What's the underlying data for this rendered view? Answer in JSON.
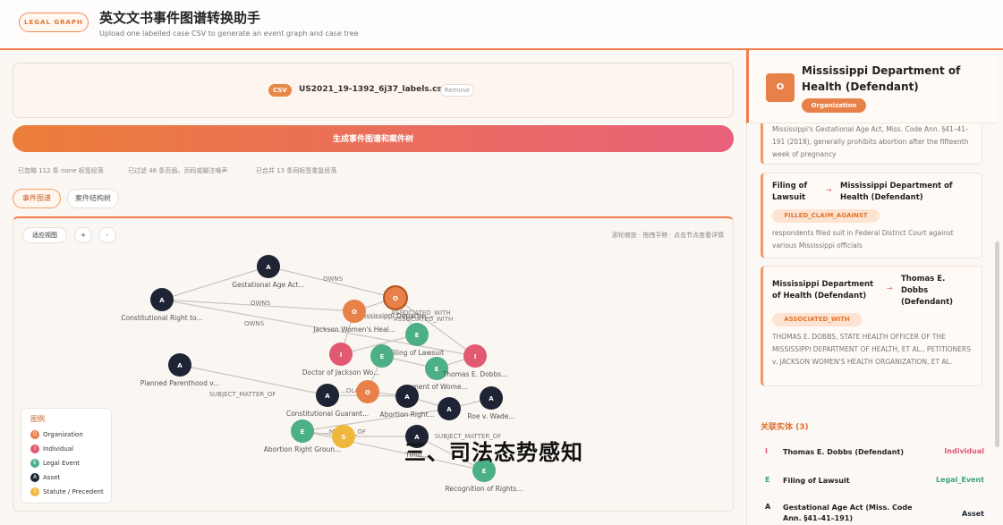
{
  "header": {
    "brand": "LEGAL GRAPH",
    "title": "英文文书事件图谱转换助手",
    "subtitle": "Upload one labelled case CSV to generate an event graph and case tree"
  },
  "upload": {
    "tag": "CSV",
    "filename": "US2021_19-1392_6j37_labels.csv",
    "remove": "Remove"
  },
  "generate_button": "生成事件图谱和案件树",
  "stats": [
    "已忽略 112 条 none 标签段落",
    "已过滤 46 条页眉、页码或脚注噪声",
    "已合并 13 条同标签重复段落"
  ],
  "tabs": [
    "事件图谱",
    "案件结构树"
  ],
  "graph": {
    "toolbar": {
      "fit": "适应视图",
      "zoom_in": "+",
      "zoom_out": "-"
    },
    "hint": "滚轮缩放 · 拖拽平移 · 点击节点查看详情",
    "nodes": [
      {
        "id": "n1",
        "k": "A",
        "label": "Gestational Age Act..."
      },
      {
        "id": "n2",
        "k": "A",
        "label": "Constitutional Right to..."
      },
      {
        "id": "n3",
        "k": "O",
        "label": "Mississippi Departm..."
      },
      {
        "id": "n4",
        "k": "O",
        "label": "Jackson Women's Heal..."
      },
      {
        "id": "n5",
        "k": "E",
        "label": "Filing of Lawsuit"
      },
      {
        "id": "n6",
        "k": "I",
        "label": "Doctor of Jackson Wo..."
      },
      {
        "id": "n7",
        "k": "E",
        "label": ""
      },
      {
        "id": "n8",
        "k": "E",
        "label": "...ment of Wome..."
      },
      {
        "id": "n9",
        "k": "I",
        "label": "Thomas E. Dobbs..."
      },
      {
        "id": "n10",
        "k": "A",
        "label": "Planned Parenthood v..."
      },
      {
        "id": "n11",
        "k": "A",
        "label": "Constitutional Guarant..."
      },
      {
        "id": "n12",
        "k": "O",
        "label": ""
      },
      {
        "id": "n13",
        "k": "A",
        "label": "Abortion Right..."
      },
      {
        "id": "n14",
        "k": "A",
        "label": "Roe v. Wade..."
      },
      {
        "id": "n15",
        "k": "A",
        "label": ""
      },
      {
        "id": "n16",
        "k": "E",
        "label": "Abortion Right Groun..."
      },
      {
        "id": "n17",
        "k": "S",
        "label": ""
      },
      {
        "id": "n18",
        "k": "A",
        "label": "Timb..."
      },
      {
        "id": "n19",
        "k": "E",
        "label": "Recognition of Rights..."
      }
    ],
    "edge_labels": [
      "OWNS",
      "OWNS",
      "OWNS",
      "ASSOCIATED_WITH",
      "...ASSOCIATED_WITH",
      "SUBJECT_MATTER_OF",
      "...OLATES",
      "...MATTER_OF",
      "SUBJECT_MATTER_OF"
    ]
  },
  "legend": {
    "title": "图例",
    "items": [
      {
        "k": "O",
        "label": "Organization",
        "color": "#e8804a"
      },
      {
        "k": "I",
        "label": "Individual",
        "color": "#e25a72"
      },
      {
        "k": "E",
        "label": "Legal Event",
        "color": "#4caf86"
      },
      {
        "k": "A",
        "label": "Asset",
        "color": "#1e2433"
      },
      {
        "k": "S",
        "label": "Statute / Precedent",
        "color": "#f0b83a"
      }
    ]
  },
  "entity": {
    "icon": "O",
    "name": "Mississippi Department of Health (Defendant)",
    "type": "Organization"
  },
  "relations": [
    {
      "text": "Mississippi's Gestational Age Act, Miss. Code Ann. §41–41–191 (2018), generally prohibits abortion after the fifteenth week of pregnancy"
    },
    {
      "from": "Filing of Lawsuit",
      "to": "Mississippi Department of Health (Defendant)",
      "type": "FILLED_CLAIM_AGAINST",
      "text": "respondents filed suit in Federal District Court against various Mississippi officials"
    },
    {
      "from": "Mississippi Department of Health (Defendant)",
      "to": "Thomas E. Dobbs (Defendant)",
      "type": "ASSOCIATED_WITH",
      "text": "THOMAS E. DOBBS, STATE HEALTH OFFICER OF THE MISSISSIPPI DEPARTMENT OF HEALTH, ET AL., PETITIONERS v. JACKSON WOMEN'S HEALTH ORGANIZATION, ET AL."
    }
  ],
  "related_entities": {
    "title": "关联实体 (3)",
    "items": [
      {
        "k": "I",
        "name": "Thomas E. Dobbs (Defendant)",
        "type": "Individual",
        "color": "#e25a72"
      },
      {
        "k": "E",
        "name": "Filing of Lawsuit",
        "type": "Legal_Event",
        "color": "#3aa672"
      },
      {
        "k": "A",
        "name": "Gestational Age Act (Miss. Code Ann. §41–41–191)",
        "type": "Asset",
        "color": "#1e2433"
      }
    ]
  },
  "overlay_caption": "三、司法态势感知"
}
